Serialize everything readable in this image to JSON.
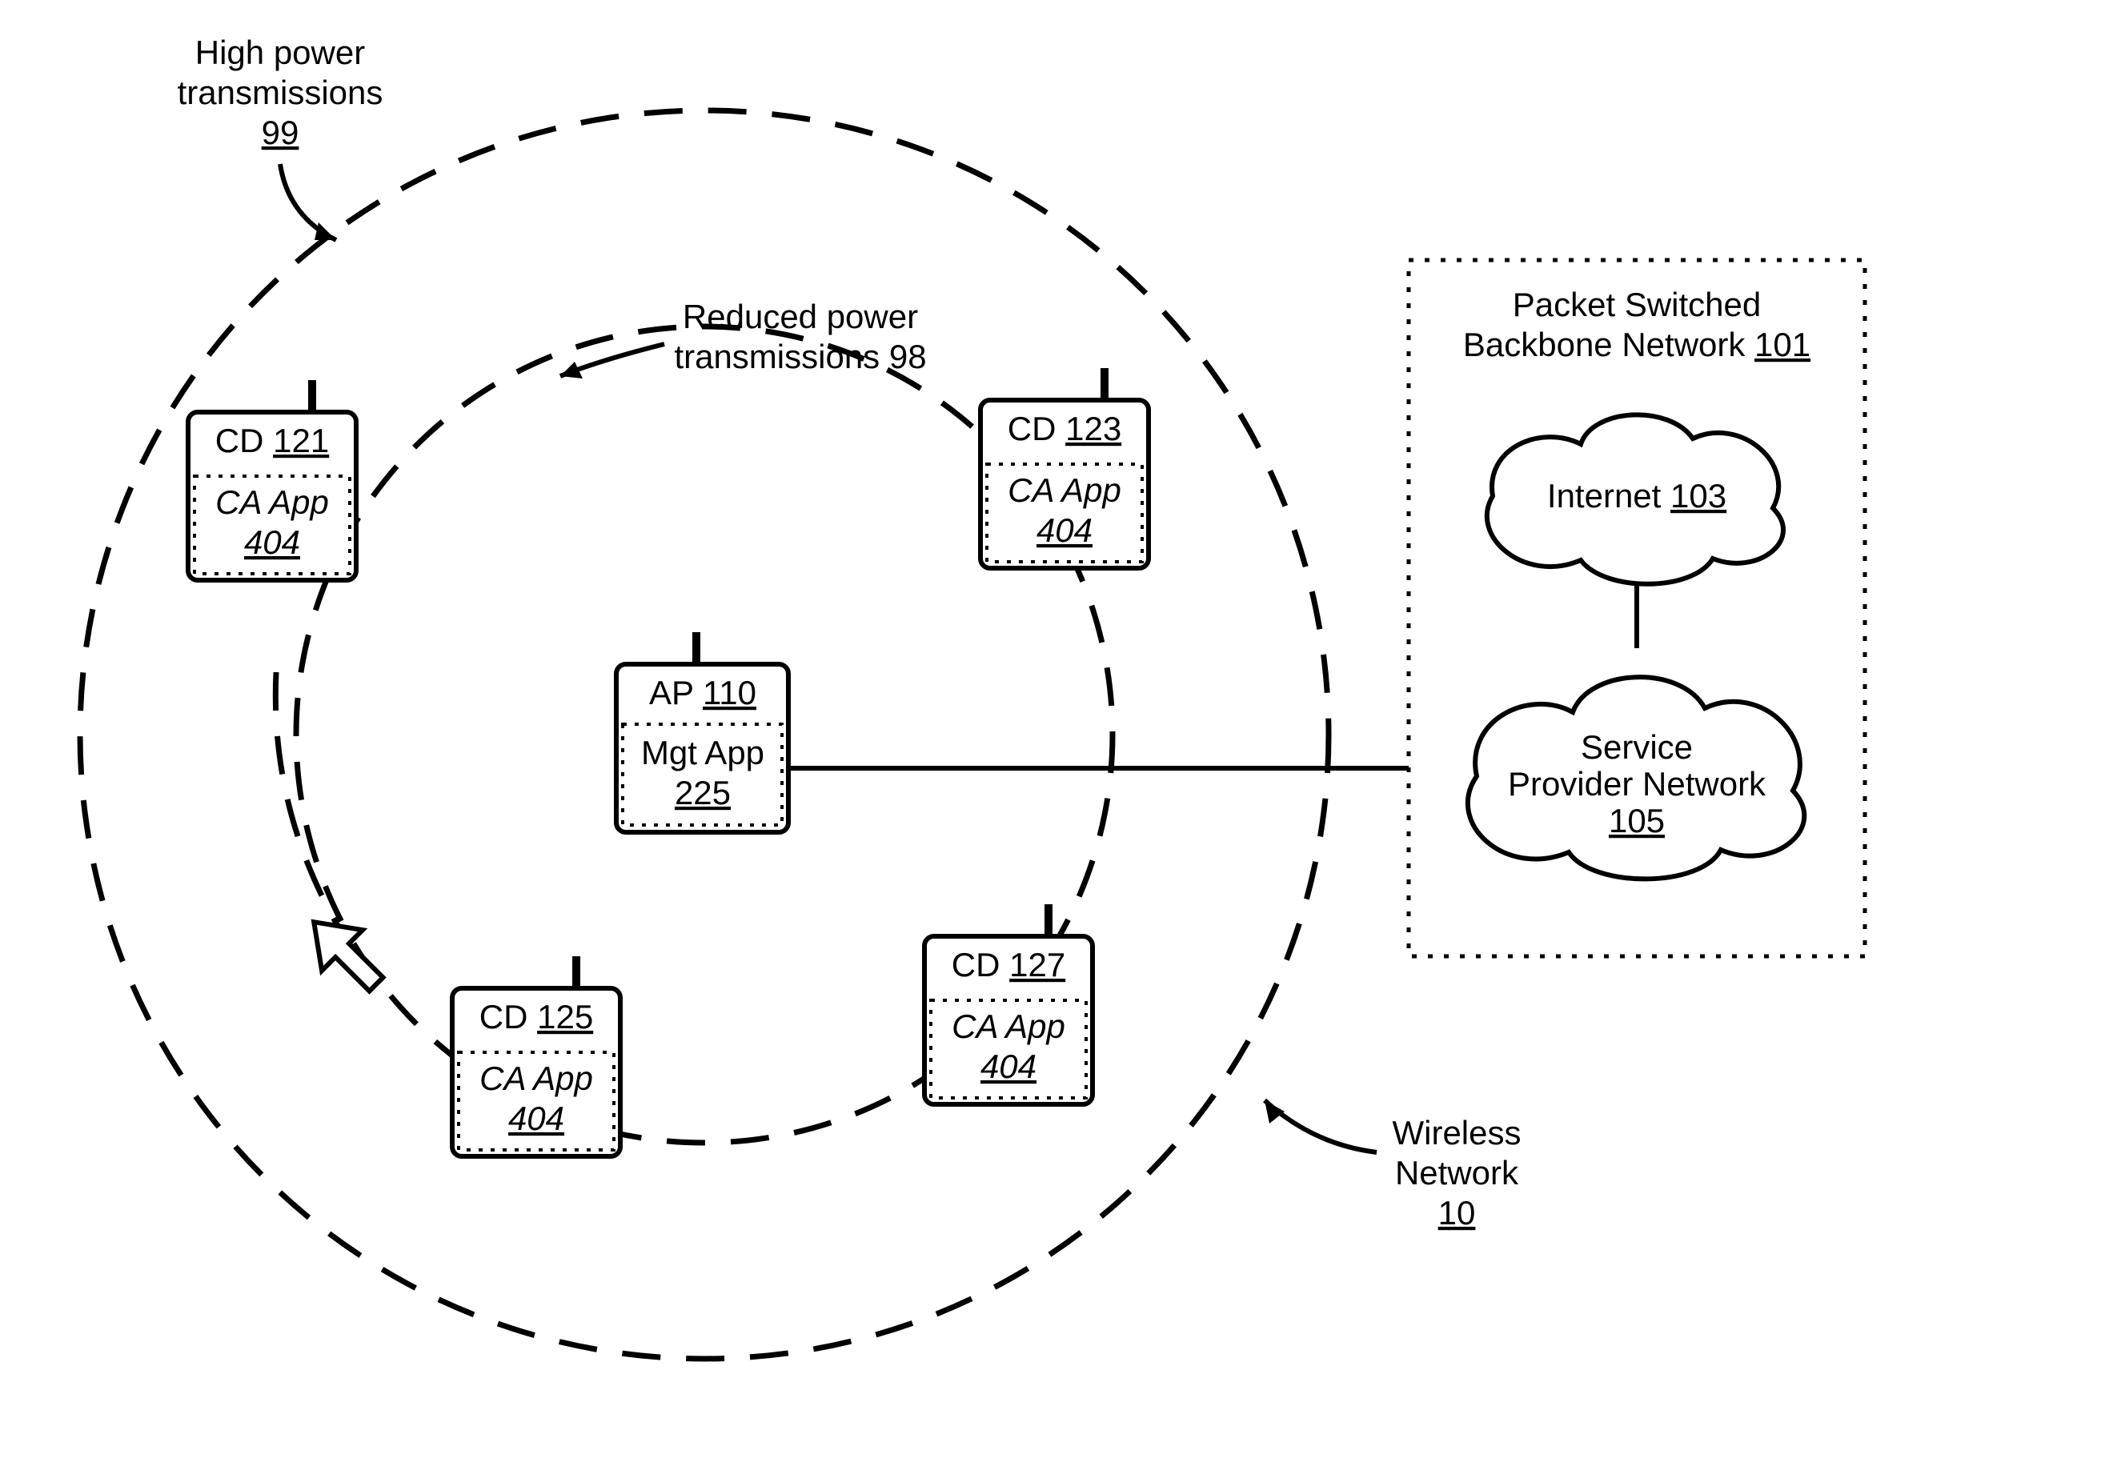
{
  "labels": {
    "high_power_l1": "High power",
    "high_power_l2": "transmissions",
    "high_power_ref": "99",
    "reduced_l1": "Reduced power",
    "reduced_l2": "transmissions 98",
    "wireless_l1": "Wireless",
    "wireless_l2": "Network",
    "wireless_ref": "10",
    "backbone_l1": "Packet Switched",
    "backbone_l2a": "Backbone Network",
    "backbone_l2b": "101",
    "internet_a": "Internet  ",
    "internet_ref": "103",
    "spn_l1": "Service",
    "spn_l2": "Provider Network",
    "spn_ref": "105",
    "ap_a": "AP ",
    "ap_ref": "110",
    "ap_mgt_l1": "Mgt App",
    "ap_mgt_ref": "225",
    "cd_prefix": "CD ",
    "cd121_ref": "121",
    "cd123_ref": "123",
    "cd125_ref": "125",
    "cd127_ref": "127",
    "ca_app": "CA App",
    "ca_app_ref": "404"
  }
}
